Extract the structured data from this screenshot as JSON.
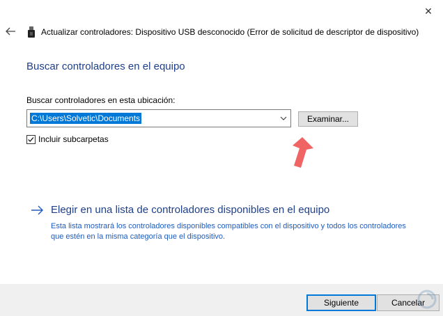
{
  "window": {
    "title": "Actualizar controladores: Dispositivo USB desconocido (Error de solicitud de descriptor de dispositivo)",
    "close_symbol": "✕"
  },
  "main": {
    "heading": "Buscar controladores en el equipo",
    "location_label": "Buscar controladores en esta ubicación:",
    "location_value": "C:\\Users\\Solvetic\\Documents",
    "browse_label": "Examinar...",
    "include_subfolders_label": "Incluir subcarpetas",
    "include_subfolders_checked": true
  },
  "link": {
    "title": "Elegir en una lista de controladores disponibles en el equipo",
    "description": "Esta lista mostrará los controladores disponibles compatibles con el dispositivo y todos los controladores que estén en la misma categoría que el dispositivo."
  },
  "footer": {
    "next_label": "Siguiente",
    "cancel_label": "Cancelar"
  },
  "colors": {
    "accent": "#0078d7",
    "heading": "#1e3f8a",
    "annotation_arrow": "#f05a5a"
  },
  "icons": {
    "back": "back-arrow-icon",
    "device": "usb-device-icon",
    "close": "close-icon",
    "dropdown": "chevron-down-icon",
    "link": "arrow-right-icon",
    "pointer": "red-pointer-arrow-icon"
  }
}
